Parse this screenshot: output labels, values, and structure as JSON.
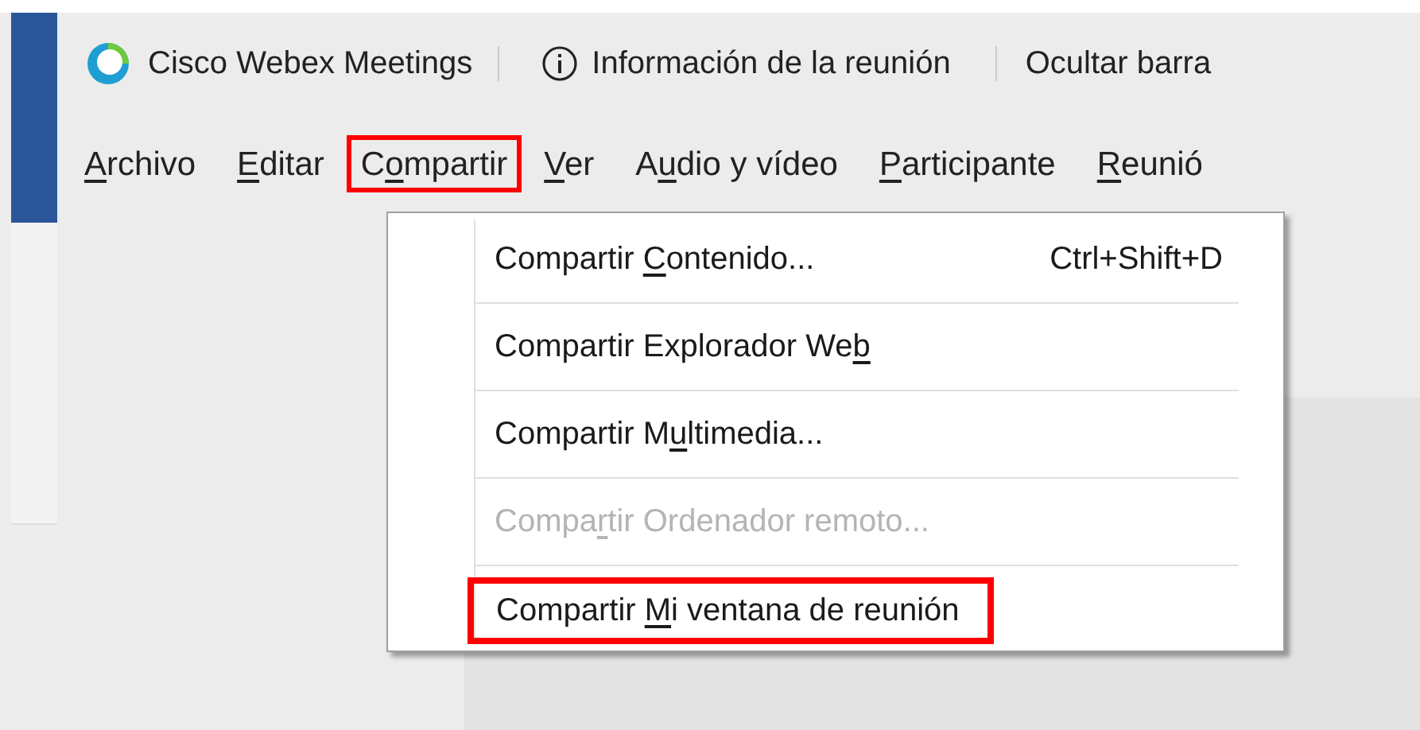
{
  "toolbar": {
    "app_name": "Cisco Webex Meetings",
    "info": "Información de la reunión",
    "hide": "Ocultar barra"
  },
  "menu_bar": [
    {
      "key": "A",
      "post": "rchivo",
      "highlighted": false
    },
    {
      "key": "E",
      "post": "ditar",
      "highlighted": false
    },
    {
      "pre": "C",
      "key": "o",
      "post": "mpartir",
      "highlighted": true
    },
    {
      "key": "V",
      "post": "er",
      "highlighted": false
    },
    {
      "pre": "A",
      "key": "u",
      "post": "dio y vídeo",
      "highlighted": false
    },
    {
      "key": "P",
      "post": "articipante",
      "highlighted": false
    },
    {
      "key": "R",
      "post": "eunió",
      "highlighted": false
    }
  ],
  "dropdown": [
    {
      "pre": "Compartir ",
      "key": "C",
      "post": "ontenido...",
      "shortcut": "Ctrl+Shift+D",
      "disabled": false,
      "highlighted": false
    },
    {
      "pre": "Compartir Explorador We",
      "key": "b",
      "disabled": false,
      "highlighted": false
    },
    {
      "pre": "Compartir M",
      "key": "u",
      "post": "ltimedia...",
      "disabled": false,
      "highlighted": false
    },
    {
      "pre": "Compa",
      "key": "r",
      "post": "tir Ordenador remoto...",
      "disabled": true,
      "highlighted": false
    },
    {
      "pre": "Compartir ",
      "key": "M",
      "post": "i ventana de reunión",
      "disabled": false,
      "highlighted": true
    }
  ]
}
